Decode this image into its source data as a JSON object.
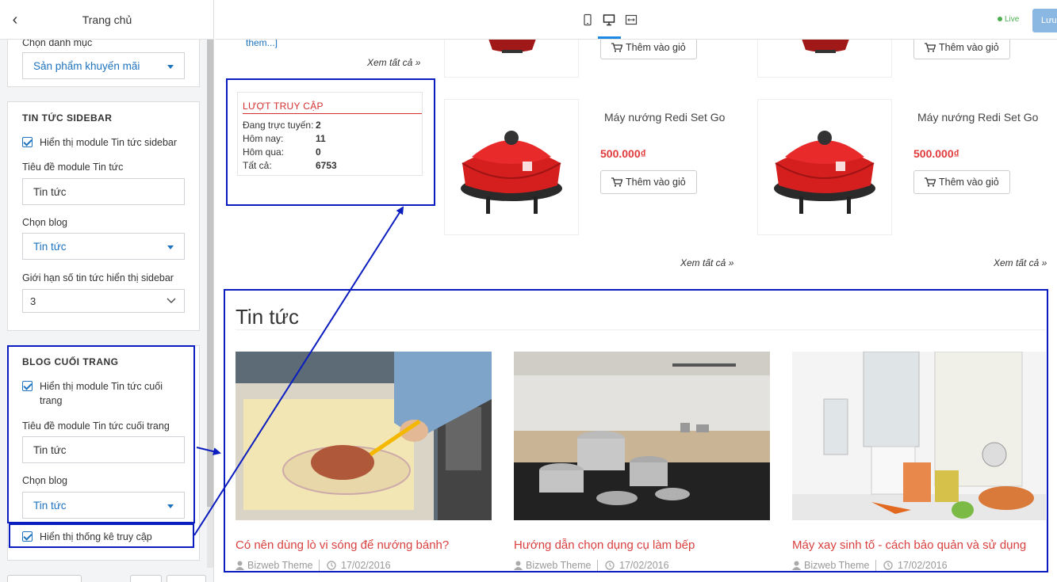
{
  "sidebar": {
    "title": "Trang chủ",
    "category_label": "Chọn danh mục",
    "category_value": "Sản phẩm khuyến mãi",
    "news_sidebar": {
      "heading": "TIN TỨC SIDEBAR",
      "show_checkbox": "Hiển thị module Tin tức sidebar",
      "title_label": "Tiêu đề module Tin tức",
      "title_value": "Tin tức",
      "blog_label": "Chọn blog",
      "blog_value": "Tin tức",
      "limit_label": "Giới hạn số tin tức hiển thị sidebar",
      "limit_value": "3"
    },
    "blog_footer": {
      "heading": "BLOG CUỐI TRANG",
      "show_checkbox_line1": "Hiển thị module Tin tức cuối",
      "show_checkbox_line2": "trang",
      "title_label": "Tiêu đề module Tin tức cuối trang",
      "title_value": "Tin tức",
      "blog_label": "Chọn blog",
      "blog_value": "Tin tức"
    },
    "stats_checkbox": "Hiển thị thống kê truy cập"
  },
  "topbar": {
    "live_label": "Live",
    "save_label": "Lưu"
  },
  "preview": {
    "read_more": "them...]",
    "see_all": "Xem tất cả »",
    "visits": {
      "title": "LƯỢT TRUY CẬP",
      "rows": [
        {
          "label": "Đang trực tuyến:",
          "value": "2"
        },
        {
          "label": "Hôm nay:",
          "value": "11"
        },
        {
          "label": "Hôm qua:",
          "value": "0"
        },
        {
          "label": "Tất cả:",
          "value": "6753"
        }
      ]
    },
    "products": [
      {
        "name": "Máy nướng Redi Set Go",
        "price": "500.000₫",
        "button": "Thêm vào giỏ"
      },
      {
        "name": "Máy nướng Redi Set Go",
        "price": "500.000₫",
        "button": "Thêm vào giỏ"
      }
    ],
    "top_buttons": [
      "Thêm vào giỏ",
      "Thêm vào giỏ"
    ],
    "news": {
      "title": "Tin tức",
      "posts": [
        {
          "title": "Có nên dùng lò vi sóng để nướng bánh?",
          "author": "Bizweb Theme",
          "date": "17/02/2016"
        },
        {
          "title": "Hướng dẫn chọn dụng cụ làm bếp",
          "author": "Bizweb Theme",
          "date": "17/02/2016"
        },
        {
          "title": "Máy xay sinh tố - cách bảo quản và sử dụng",
          "author": "Bizweb Theme",
          "date": "17/02/2016"
        }
      ]
    }
  },
  "colors": {
    "accent": "#1e73be",
    "highlight": "#0b1dbf",
    "price": "#e03a3a",
    "live": "#4caf50"
  }
}
